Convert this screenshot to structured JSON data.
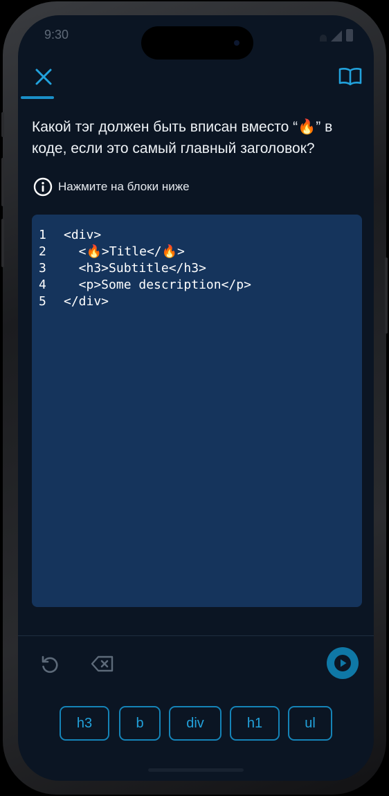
{
  "status_bar": {
    "time": "9:30"
  },
  "header": {
    "close_icon": "close-icon",
    "book_icon": "book-open-icon",
    "accent_color": "#1a8fc8"
  },
  "question": {
    "text": "Какой тэг должен быть вписан вместо “🔥” в коде, если это самый главный заголовок?"
  },
  "hint": {
    "icon": "info-icon",
    "text": "Нажмите на блоки ниже"
  },
  "code": {
    "lines": [
      {
        "no": "1",
        "text": "<div>"
      },
      {
        "no": "2",
        "text": "  <🔥>Title</🔥>"
      },
      {
        "no": "3",
        "text": "  <h3>Subtitle</h3>"
      },
      {
        "no": "4",
        "text": "  <p>Some description</p>"
      },
      {
        "no": "5",
        "text": "</div>"
      }
    ],
    "background": "#15345c"
  },
  "controls": {
    "undo_icon": "undo-icon",
    "backspace_icon": "backspace-icon",
    "run_icon": "play-icon",
    "run_color": "#0f78a6"
  },
  "options": [
    "h3",
    "b",
    "div",
    "h1",
    "ul"
  ]
}
